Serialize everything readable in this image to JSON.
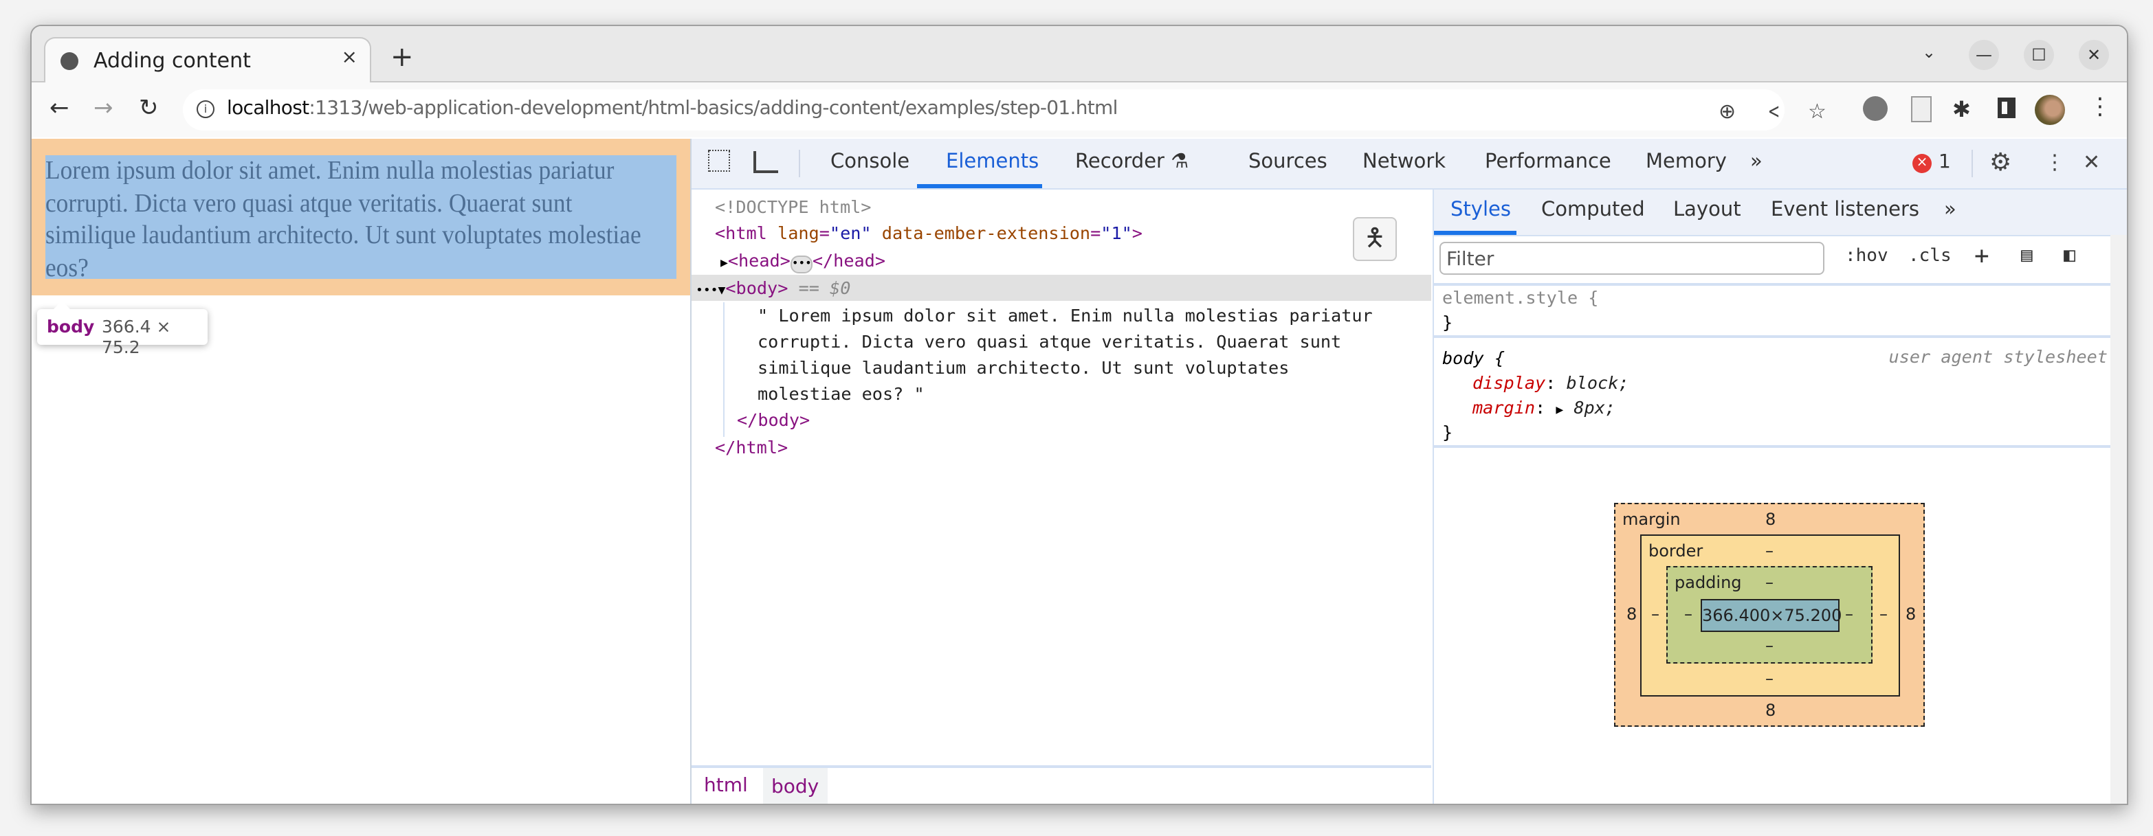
{
  "browser": {
    "tab_title": "Adding content",
    "url_host": "localhost",
    "url_rest": ":1313/web-application-development/html-basics/adding-content/examples/step-01.html",
    "icons": {
      "tab_favicon": "globe-icon",
      "tab_close": "×",
      "new_tab": "+",
      "tab_search": "⌄",
      "minimize": "—",
      "maximize": "☐",
      "close": "✕",
      "back": "←",
      "forward": "→",
      "reload": "↻",
      "zoom": "⊕",
      "share": "<",
      "bookmark": "☆",
      "menu": "⋮"
    }
  },
  "page": {
    "body_text": "Lorem ipsum dolor sit amet. Enim nulla molestias pariatur corrupti. Dicta vero quasi atque veritatis. Quaerat sunt similique laudantium architecto. Ut sunt voluptates molestiae eos?",
    "highlight_colors": {
      "margin": "#f8cc9c",
      "content": "#a0c4e8"
    },
    "tooltip": {
      "tag": "body",
      "dimensions": "366.4 × 75.2"
    }
  },
  "devtools": {
    "tabs": [
      {
        "label": "Console",
        "active": false
      },
      {
        "label": "Elements",
        "active": true
      },
      {
        "label": "Recorder",
        "active": false
      },
      {
        "label": "Sources",
        "active": false
      },
      {
        "label": "Network",
        "active": false
      },
      {
        "label": "Performance",
        "active": false
      },
      {
        "label": "Memory",
        "active": false
      }
    ],
    "more_tabs": "»",
    "error_count": "1",
    "accent": "#1a73e8",
    "dom": {
      "doctype": "<!DOCTYPE html>",
      "html_open_tag": "<html",
      "html_attr1_name": "lang",
      "html_attr1_value": "\"en\"",
      "html_attr2_name": "data-ember-extension",
      "html_attr2_value": "\"1\"",
      "head_open": "<head>",
      "head_close": "</head>",
      "body_open": "<body>",
      "selected_marker": "== $0",
      "text_lines": [
        "\" Lorem ipsum dolor sit amet. Enim nulla molestias pariatur",
        "corrupti. Dicta vero quasi atque veritatis. Quaerat sunt",
        "similique laudantium architecto. Ut sunt voluptates",
        "molestiae eos? \""
      ],
      "body_close": "</body>",
      "html_close": "</html>"
    },
    "breadcrumbs": [
      "html",
      "body"
    ],
    "styles_panel": {
      "tabs": [
        {
          "label": "Styles",
          "active": true
        },
        {
          "label": "Computed",
          "active": false
        },
        {
          "label": "Layout",
          "active": false
        },
        {
          "label": "Event listeners",
          "active": false
        }
      ],
      "more_tabs": "»",
      "filter_placeholder": "Filter",
      "hov_label": ":hov",
      "cls_label": ".cls",
      "rules": {
        "element_style_selector": "element.style {",
        "close_brace": "}",
        "body_selector": "body {",
        "body_source": "user agent stylesheet",
        "props": [
          {
            "name": "display",
            "value": "block;"
          },
          {
            "name": "margin",
            "value": "8px;"
          }
        ]
      },
      "box_model": {
        "margin_label": "margin",
        "border_label": "border",
        "padding_label": "padding",
        "margin": {
          "top": "8",
          "right": "8",
          "bottom": "8",
          "left": "8"
        },
        "border": {
          "top": "–",
          "right": "–",
          "bottom": "–",
          "left": "–"
        },
        "padding": {
          "top": "–",
          "right": "–",
          "bottom": "–",
          "left": "–"
        },
        "content": "366.400×75.200"
      }
    }
  }
}
